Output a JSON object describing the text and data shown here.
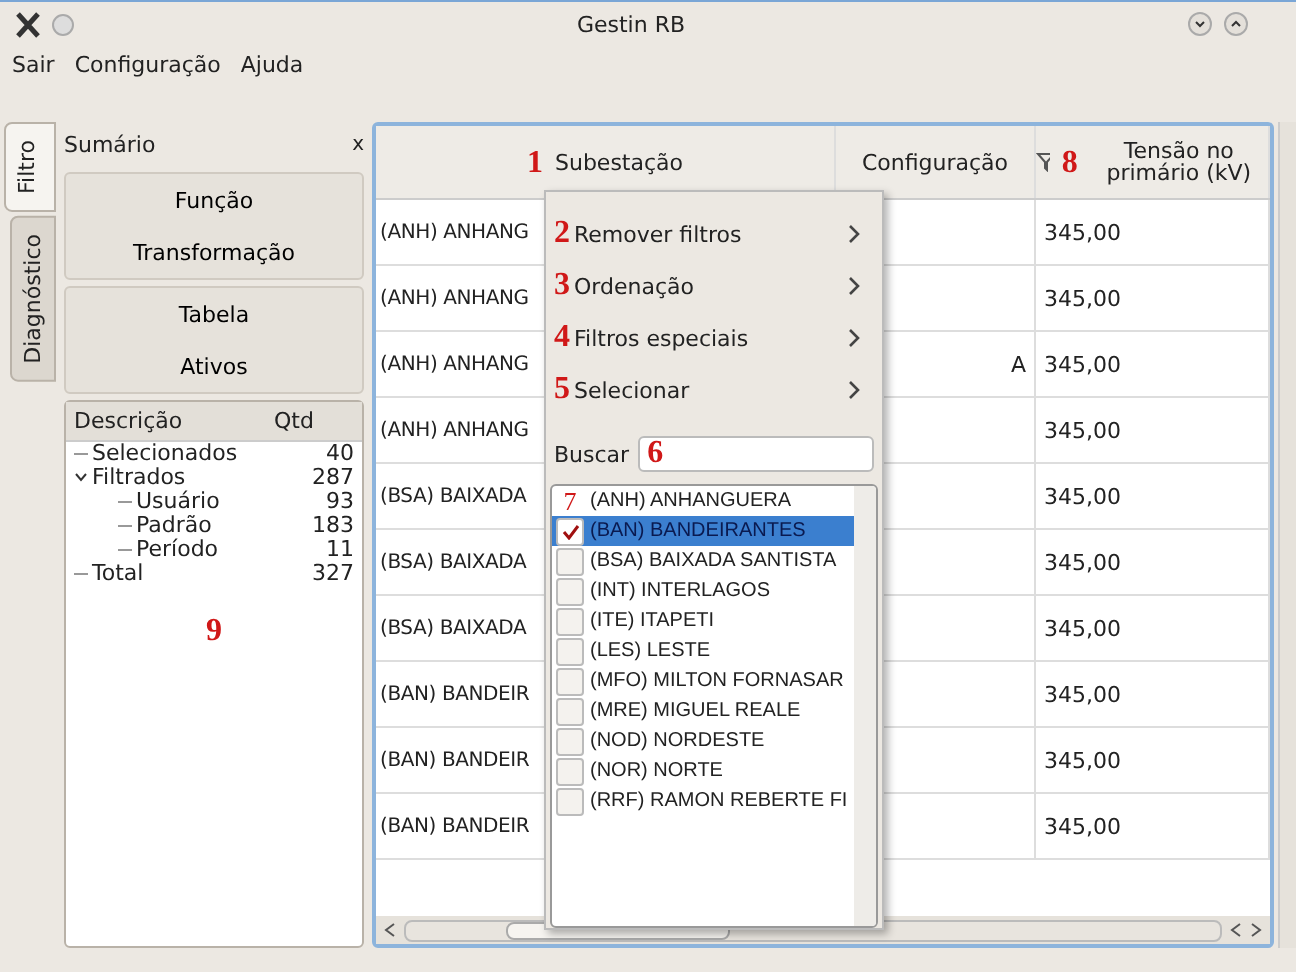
{
  "window": {
    "title": "Gestin RB"
  },
  "menu": [
    "Sair",
    "Configuração",
    "Ajuda"
  ],
  "side_tabs": [
    {
      "label": "Filtro",
      "selected": true
    },
    {
      "label": "Diagnóstico",
      "selected": false
    }
  ],
  "summary": {
    "title": "Sumário",
    "close": "x",
    "button_groups": [
      [
        "Função",
        "Transformação"
      ],
      [
        "Tabela",
        "Ativos"
      ]
    ],
    "tree": {
      "columns": [
        "Descrição",
        "Qtd"
      ],
      "callout": "9",
      "items": [
        {
          "label": "Selecionados",
          "count": "40"
        },
        {
          "label": "Filtrados",
          "count": "287",
          "expanded": true,
          "children": [
            {
              "label": "Usuário",
              "count": "93"
            },
            {
              "label": "Padrão",
              "count": "183"
            },
            {
              "label": "Período",
              "count": "11"
            }
          ]
        },
        {
          "label": "Total",
          "count": "327"
        }
      ]
    }
  },
  "table": {
    "columns": [
      {
        "label": "Subestação",
        "callout": "1"
      },
      {
        "label": "Configuração"
      },
      {
        "label": "Tensão no primário (kV)",
        "filter": true,
        "callout": "8"
      }
    ],
    "rows": [
      {
        "substation": "(ANH) ANHANG",
        "voltage": "345,00"
      },
      {
        "substation": "(ANH) ANHANG",
        "voltage": "345,00"
      },
      {
        "substation": "(ANH) ANHANG",
        "configuration": "A",
        "voltage": "345,00"
      },
      {
        "substation": "(ANH) ANHANG",
        "voltage": "345,00"
      },
      {
        "substation": "(BSA) BAIXADA",
        "voltage": "345,00"
      },
      {
        "substation": "(BSA) BAIXADA",
        "voltage": "345,00"
      },
      {
        "substation": "(BSA) BAIXADA",
        "voltage": "345,00"
      },
      {
        "substation": "(BAN) BANDEIR",
        "voltage": "345,00"
      },
      {
        "substation": "(BAN) BANDEIR",
        "voltage": "345,00"
      },
      {
        "substation": "(BAN) BANDEIR",
        "voltage": "345,00"
      }
    ]
  },
  "popup": {
    "items": [
      {
        "label": "Remover filtros",
        "callout": "2"
      },
      {
        "label": "Ordenação",
        "callout": "3"
      },
      {
        "label": "Filtros especiais",
        "callout": "4"
      },
      {
        "label": "Selecionar",
        "callout": "5"
      }
    ],
    "search": {
      "label": "Buscar",
      "callout": "6"
    },
    "options": [
      {
        "label": "(ANH) ANHANGUERA",
        "checked": false,
        "selected": false,
        "callout": "7"
      },
      {
        "label": "(BAN) BANDEIRANTES",
        "checked": true,
        "selected": true
      },
      {
        "label": "(BSA) BAIXADA SANTISTA",
        "checked": false,
        "selected": false
      },
      {
        "label": "(INT) INTERLAGOS",
        "checked": false,
        "selected": false
      },
      {
        "label": "(ITE) ITAPETI",
        "checked": false,
        "selected": false
      },
      {
        "label": "(LES) LESTE",
        "checked": false,
        "selected": false
      },
      {
        "label": "(MFO) MILTON FORNASAR",
        "checked": false,
        "selected": false
      },
      {
        "label": "(MRE) MIGUEL REALE",
        "checked": false,
        "selected": false
      },
      {
        "label": "(NOD) NORDESTE",
        "checked": false,
        "selected": false
      },
      {
        "label": "(NOR) NORTE",
        "checked": false,
        "selected": false
      },
      {
        "label": "(RRF) RAMON REBERTE FI",
        "checked": false,
        "selected": false
      }
    ]
  }
}
